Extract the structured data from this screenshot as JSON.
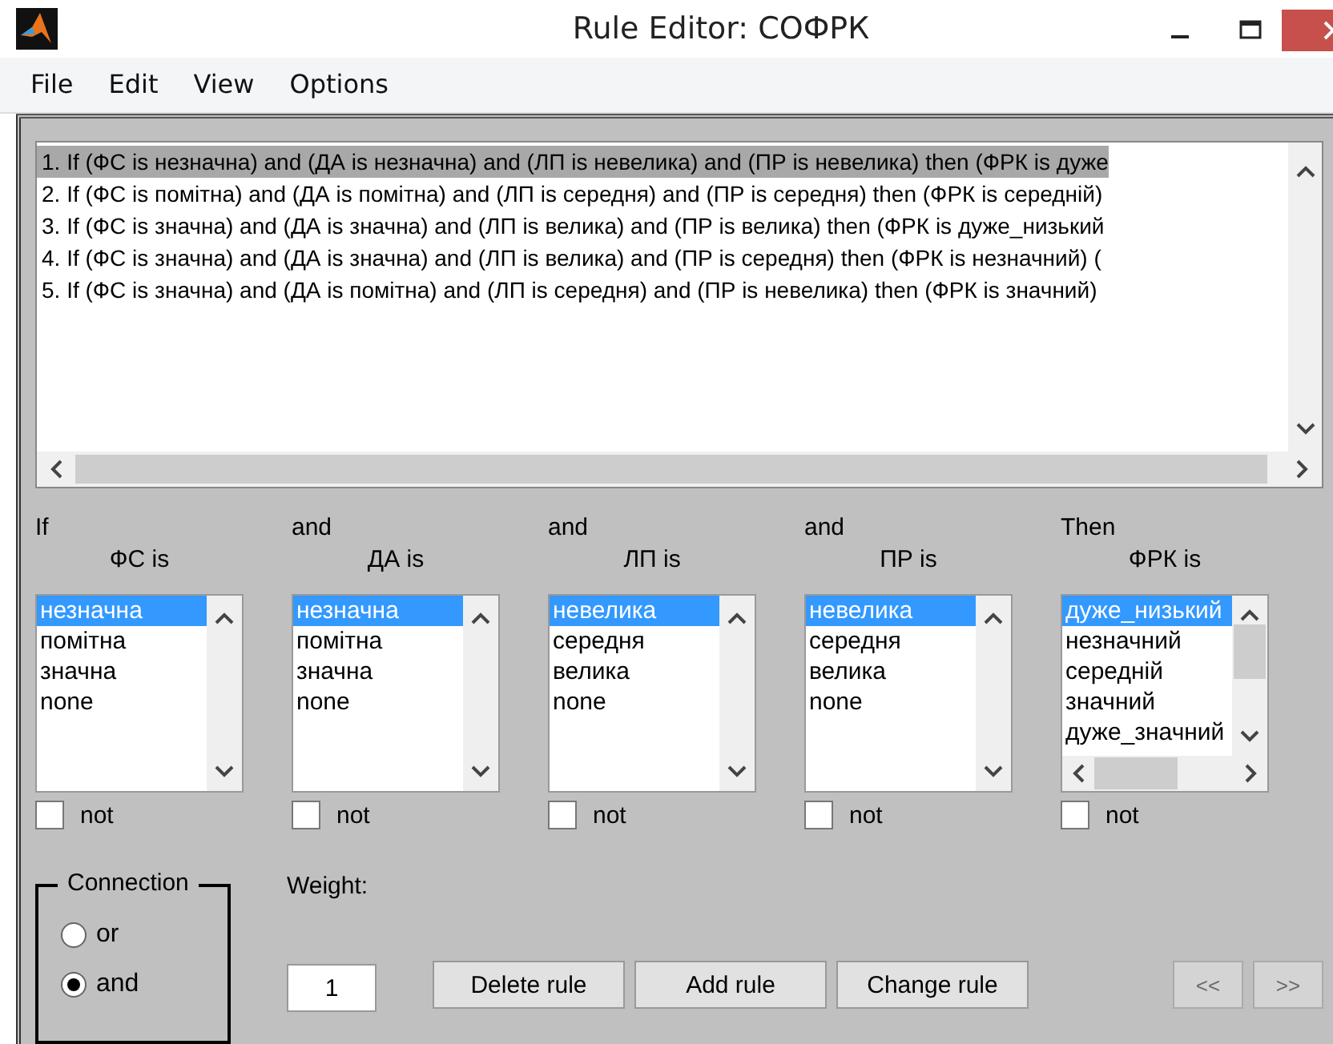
{
  "window": {
    "title": "Rule Editor: СОФРК"
  },
  "menu": [
    "File",
    "Edit",
    "View",
    "Options"
  ],
  "rules": [
    {
      "text": "1. If (ФС is незначна) and (ДА is незначна) and (ЛП is невелика) and (ПР is невелика) then (ФРК is дуже",
      "selected": true
    },
    {
      "text": "2. If (ФС is помітна) and (ДА is помітна) and (ЛП is середня) and (ПР is середня) then (ФРК is середній)",
      "selected": false
    },
    {
      "text": "3. If (ФС is значна) and (ДА is значна) and (ЛП is велика) and (ПР is велика) then (ФРК is дуже_низький",
      "selected": false
    },
    {
      "text": "4. If (ФС is значна) and (ДА is значна) and (ЛП is велика) and (ПР is середня) then (ФРК is незначний) (",
      "selected": false
    },
    {
      "text": "5. If (ФС is значна) and (ДА is помітна) and (ЛП is середня) and (ПР is невелика) then (ФРК is значний)",
      "selected": false
    }
  ],
  "variables": [
    {
      "connective": "If",
      "label": "ФС is",
      "not": false,
      "not_label": "not",
      "hscroll": false,
      "options": [
        {
          "text": "незначна",
          "selected": true
        },
        {
          "text": "помітна",
          "selected": false
        },
        {
          "text": "значна",
          "selected": false
        },
        {
          "text": "none",
          "selected": false
        }
      ]
    },
    {
      "connective": "and",
      "label": "ДА is",
      "not": false,
      "not_label": "not",
      "hscroll": false,
      "options": [
        {
          "text": "незначна",
          "selected": true
        },
        {
          "text": "помітна",
          "selected": false
        },
        {
          "text": "значна",
          "selected": false
        },
        {
          "text": "none",
          "selected": false
        }
      ]
    },
    {
      "connective": "and",
      "label": "ЛП is",
      "not": false,
      "not_label": "not",
      "hscroll": false,
      "options": [
        {
          "text": "невелика",
          "selected": true
        },
        {
          "text": "середня",
          "selected": false
        },
        {
          "text": "велика",
          "selected": false
        },
        {
          "text": "none",
          "selected": false
        }
      ]
    },
    {
      "connective": "and",
      "label": "ПР is",
      "not": false,
      "not_label": "not",
      "hscroll": false,
      "options": [
        {
          "text": "невелика",
          "selected": true
        },
        {
          "text": "середня",
          "selected": false
        },
        {
          "text": "велика",
          "selected": false
        },
        {
          "text": "none",
          "selected": false
        }
      ]
    },
    {
      "connective": "Then",
      "label": "ФРК is",
      "not": false,
      "not_label": "not",
      "hscroll": true,
      "options": [
        {
          "text": "дуже_низький",
          "selected": true
        },
        {
          "text": "незначний",
          "selected": false
        },
        {
          "text": "середній",
          "selected": false
        },
        {
          "text": "значний",
          "selected": false
        },
        {
          "text": "дуже_значний",
          "selected": false
        }
      ]
    }
  ],
  "connection": {
    "title": "Connection",
    "options": [
      {
        "label": "or",
        "selected": false
      },
      {
        "label": "and",
        "selected": true
      }
    ]
  },
  "weight": {
    "label": "Weight:",
    "value": "1"
  },
  "buttons": [
    {
      "label": "Delete rule"
    },
    {
      "label": "Add rule"
    },
    {
      "label": "Change rule"
    }
  ],
  "nav_buttons": [
    {
      "label": "<<",
      "disabled": true
    },
    {
      "label": ">>",
      "disabled": true
    }
  ]
}
